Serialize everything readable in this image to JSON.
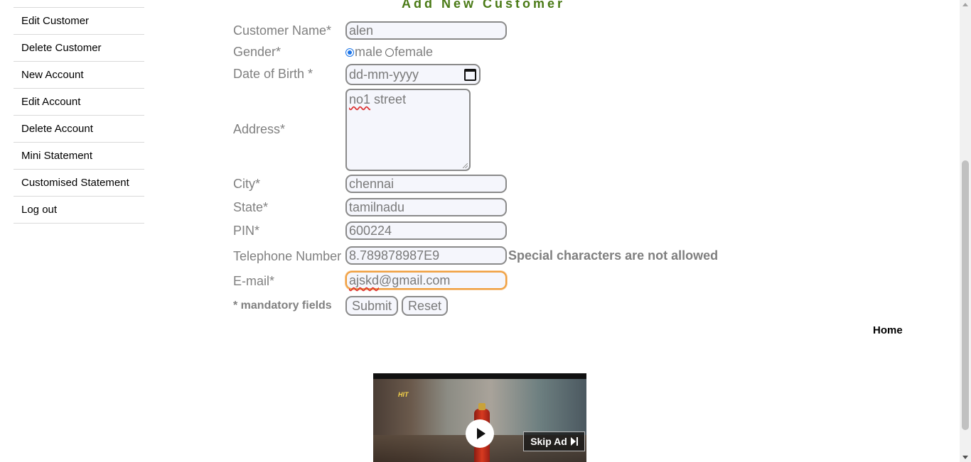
{
  "sidebar": {
    "items": [
      {
        "label": "Edit Customer"
      },
      {
        "label": "Delete Customer"
      },
      {
        "label": "New Account"
      },
      {
        "label": "Edit Account"
      },
      {
        "label": "Delete Account"
      },
      {
        "label": "Mini Statement"
      },
      {
        "label": "Customised Statement"
      },
      {
        "label": "Log out"
      }
    ]
  },
  "form": {
    "title": "Add New Customer",
    "customer_name": {
      "label": "Customer Name*",
      "value": "alen"
    },
    "gender": {
      "label": "Gender*",
      "options": [
        "male",
        "female"
      ],
      "selected": "male"
    },
    "dob": {
      "label": "Date of Birth *",
      "placeholder": "dd-mm-yyyy"
    },
    "address": {
      "label": "Address*",
      "value_misspelled": "no1",
      "value_rest": " street"
    },
    "city": {
      "label": "City*",
      "value": "chennai"
    },
    "state": {
      "label": "State*",
      "value": "tamilnadu"
    },
    "pin": {
      "label": "PIN*",
      "value": "600224"
    },
    "telephone": {
      "label": "Telephone Number",
      "value": "8.789878987E9",
      "error": "Special characters are not allowed"
    },
    "email": {
      "label": "E-mail*",
      "value_misspelled": "ajskd",
      "value_rest": "@gmail.com"
    },
    "mandatory_note": "* mandatory fields",
    "submit_label": "Submit",
    "reset_label": "Reset"
  },
  "home_link": "Home",
  "ad": {
    "skip_label": "Skip Ad",
    "brand_text": "HIT",
    "icons": {
      "play": "play-icon",
      "skip": "skip-next-icon",
      "calendar": "calendar-icon"
    }
  }
}
